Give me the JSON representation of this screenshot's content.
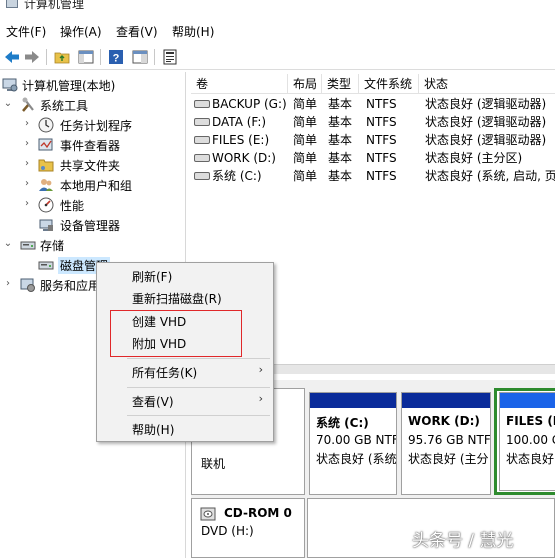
{
  "window": {
    "title": "计算机管理"
  },
  "menu": [
    "文件(F)",
    "操作(A)",
    "查看(V)",
    "帮助(H)"
  ],
  "toolbar": {
    "buttons": [
      "back-icon",
      "forward-icon",
      "folder-up-icon",
      "show-hide-tree-icon",
      "help-icon",
      "properties-icon",
      "extra-icon"
    ]
  },
  "tree": {
    "items": [
      {
        "label": "计算机管理(本地)",
        "icon": "computer-mgmt-icon"
      },
      {
        "label": "系统工具",
        "icon": "tools-icon"
      },
      {
        "label": "任务计划程序",
        "icon": "clock-icon"
      },
      {
        "label": "事件查看器",
        "icon": "event-viewer-icon"
      },
      {
        "label": "共享文件夹",
        "icon": "shared-folder-icon"
      },
      {
        "label": "本地用户和组",
        "icon": "users-icon"
      },
      {
        "label": "性能",
        "icon": "performance-icon"
      },
      {
        "label": "设备管理器",
        "icon": "device-manager-icon"
      },
      {
        "label": "存储",
        "icon": "storage-icon"
      },
      {
        "label": "磁盘管理",
        "icon": "disk-icon"
      },
      {
        "label": "服务和应用",
        "icon": "services-icon"
      }
    ]
  },
  "volumes": {
    "headers": [
      "卷",
      "布局",
      "类型",
      "文件系统",
      "状态"
    ],
    "rows": [
      {
        "name": "BACKUP (G:)",
        "layout": "简单",
        "type": "基本",
        "fs": "NTFS",
        "status": "状态良好 (逻辑驱动器)"
      },
      {
        "name": "DATA (F:)",
        "layout": "简单",
        "type": "基本",
        "fs": "NTFS",
        "status": "状态良好 (逻辑驱动器)"
      },
      {
        "name": "FILES (E:)",
        "layout": "简单",
        "type": "基本",
        "fs": "NTFS",
        "status": "状态良好 (逻辑驱动器)"
      },
      {
        "name": "WORK (D:)",
        "layout": "简单",
        "type": "基本",
        "fs": "NTFS",
        "status": "状态良好 (主分区)"
      },
      {
        "name": "系统 (C:)",
        "layout": "简单",
        "type": "基本",
        "fs": "NTFS",
        "status": "状态良好 (系统, 启动, 页"
      }
    ]
  },
  "disk": {
    "status": "联机",
    "partitions": [
      {
        "name": "系统 (C:)",
        "size": "70.00 GB NTF",
        "status": "状态良好 (系统"
      },
      {
        "name": "WORK (D:)",
        "size": "95.76 GB NTF",
        "status": "状态良好 (主分"
      },
      {
        "name": "FILES (E",
        "size": "100.00 G",
        "status": "状态良好"
      }
    ],
    "cdrom": {
      "name": "CD-ROM 0",
      "drive": "DVD (H:)"
    }
  },
  "context_menu": {
    "items": [
      {
        "label": "刷新(F)"
      },
      {
        "label": "重新扫描磁盘(R)"
      },
      {
        "label": "创建 VHD"
      },
      {
        "label": "附加 VHD"
      },
      {
        "label": "所有任务(K)"
      },
      {
        "label": "查看(V)"
      },
      {
        "label": "帮助(H)"
      }
    ]
  },
  "watermark": "头条号 / 慧光",
  "colors": {
    "partition_bar": "#0a2b9a",
    "selected_partition_border": "#2e8b2e",
    "highlight_box": "#e0282a",
    "tree_selection": "#cce8ff"
  }
}
